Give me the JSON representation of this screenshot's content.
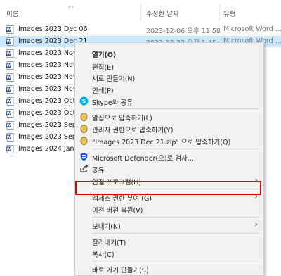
{
  "header": {
    "name": "이름",
    "date": "수정한 날짜",
    "type": "유형"
  },
  "files": [
    {
      "name": "Images 2023 Dec 06",
      "date": "2023-12-06 오후 11:58",
      "type": "Microsoft Word ..."
    },
    {
      "name": "Images 2023 Dec 21",
      "date": "2023-12-22 오전 1:45",
      "type": "Microsoft Word ...",
      "selected": true
    },
    {
      "name": "Images 2023 Nov 0",
      "date": "",
      "type": ""
    },
    {
      "name": "Images 2023 Nov 0",
      "date": "",
      "type": ""
    },
    {
      "name": "Images 2023 Nov 1",
      "date": "",
      "type": ""
    },
    {
      "name": "Images 2023 Nov 1",
      "date": "",
      "type": ""
    },
    {
      "name": "Images 2023 Oct 0",
      "date": "",
      "type": ""
    },
    {
      "name": "Images 2023 Oct 2",
      "date": "",
      "type": ""
    },
    {
      "name": "Images 2023 Sep 0",
      "date": "",
      "type": ""
    },
    {
      "name": "Images 2023 Sep 2",
      "date": "",
      "type": ""
    },
    {
      "name": "Images 2024 Jan 15",
      "date": "",
      "type": ""
    }
  ],
  "menu": {
    "open": "열기(O)",
    "edit": "편집(E)",
    "new": "새로 만들기(N)",
    "print": "인쇄(P)",
    "skype": "Skype와 공유",
    "alzip": "알집으로 압축하기(L)",
    "alzip_admin": "관리자 권한으로 압축하기(Y)",
    "alzip_named": "\"Images 2023 Dec 21.zip\" 으로 압축하기(Q)",
    "defender": "Microsoft Defender(으)로 검사...",
    "share": "공유",
    "open_with": "연결 프로그램(H)",
    "access": "액세스 권한 부여 (G)",
    "restore": "이전 버전 복원(V)",
    "send_to": "보내기(N)",
    "cut": "잘라내기(T)",
    "copy": "복사(C)",
    "shortcut": "바로 가기 만들기(S)"
  },
  "colors": {
    "selection": "#cce8ff",
    "highlight_box": "#e00000",
    "word_icon": "#2b579a",
    "skype": "#00aff0",
    "defender": "#1e64c8"
  }
}
